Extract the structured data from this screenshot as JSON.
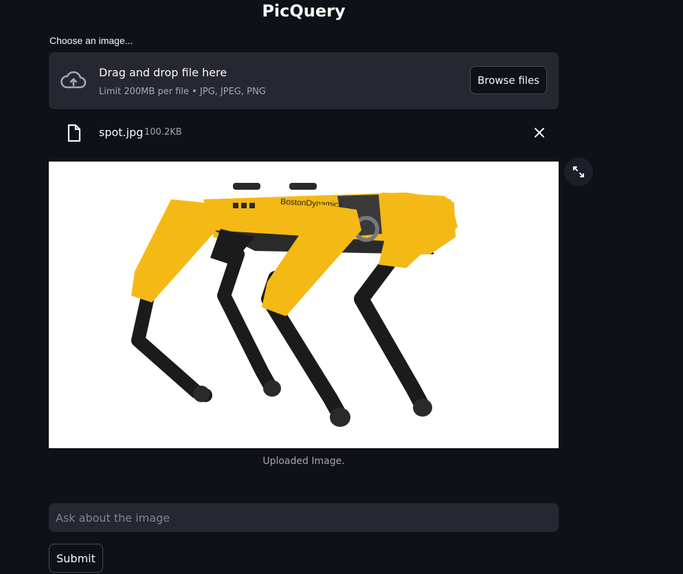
{
  "app": {
    "title": "PicQuery"
  },
  "uploader": {
    "label": "Choose an image...",
    "drop_text": "Drag and drop file here",
    "limit_text": "Limit 200MB per file • JPG, JPEG, PNG",
    "browse_label": "Browse files",
    "upload_icon": "cloud-upload-icon"
  },
  "file": {
    "name": "spot.jpg",
    "size": "100.2KB",
    "icon": "file-icon",
    "remove_icon": "close-icon"
  },
  "image": {
    "caption": "Uploaded Image.",
    "brand_text": "BostonDynamics",
    "expand_icon": "expand-icon",
    "colors": {
      "body": "#f5b916",
      "legs": "#1b1b1b",
      "background": "#ffffff"
    }
  },
  "query": {
    "placeholder": "Ask about the image",
    "value": "",
    "submit_label": "Submit"
  },
  "colors": {
    "page_bg": "#0e1117",
    "panel_bg": "#262730",
    "text": "#fafafa",
    "muted": "#a3a8b8"
  }
}
